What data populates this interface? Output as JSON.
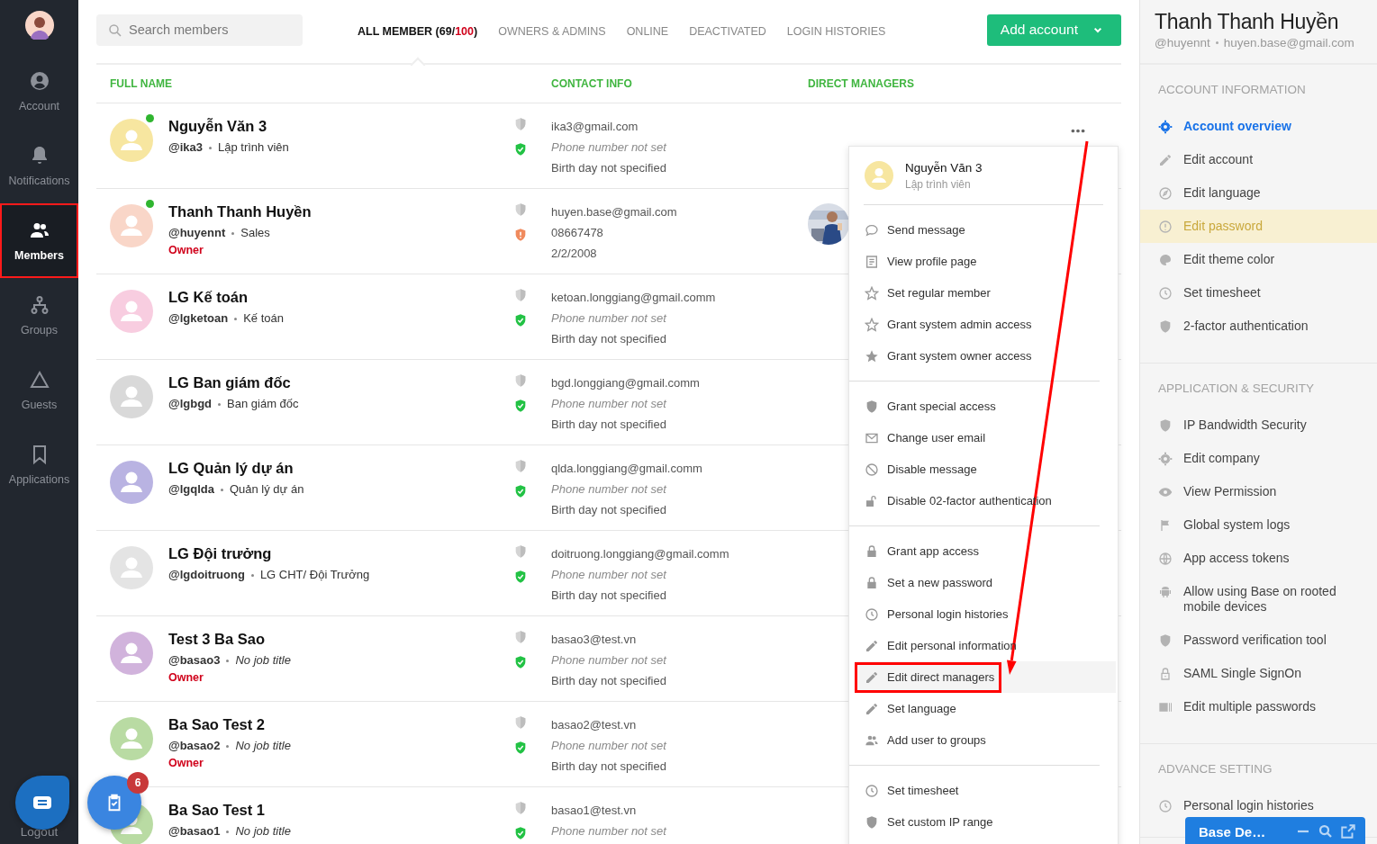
{
  "nav": {
    "items": [
      {
        "label": "Account",
        "selected": false,
        "highlighted": false
      },
      {
        "label": "Notifications",
        "selected": false,
        "highlighted": false
      },
      {
        "label": "Members",
        "selected": true,
        "highlighted": true
      },
      {
        "label": "Groups",
        "selected": false,
        "highlighted": false
      },
      {
        "label": "Guests",
        "selected": false,
        "highlighted": false
      },
      {
        "label": "Applications",
        "selected": false,
        "highlighted": false
      }
    ],
    "logout": "Logout"
  },
  "search": {
    "placeholder": "Search members"
  },
  "tabs": [
    {
      "label": "ALL MEMBER (69/",
      "limit": "100",
      "suffix": ")",
      "selected": true
    },
    {
      "label": "OWNERS & ADMINS",
      "selected": false
    },
    {
      "label": "ONLINE",
      "selected": false
    },
    {
      "label": "DEACTIVATED",
      "selected": false
    },
    {
      "label": "LOGIN HISTORIES",
      "selected": false
    }
  ],
  "add_button": {
    "label": "Add account"
  },
  "columns": [
    "FULL NAME",
    "CONTACT INFO",
    "DIRECT MANAGERS"
  ],
  "members": [
    {
      "name": "Nguyễn Văn 3",
      "username": "@ika3",
      "job": "Lập trình viên",
      "job_missing": false,
      "online": true,
      "color": "#f7e6a0",
      "verified": true,
      "email": "ika3@gmail.com",
      "phone": "Phone number not set",
      "phone_missing": true,
      "birthday": "Birth day not specified",
      "has_manager": false,
      "hovered": true
    },
    {
      "name": "Thanh Thanh Huyền",
      "username": "@huyennt",
      "job": "Sales",
      "job_missing": false,
      "role": "Owner",
      "online": true,
      "color": "#f9d6c8",
      "verified": false,
      "email": "huyen.base@gmail.com",
      "phone": "08667478",
      "phone_missing": false,
      "birthday": "2/2/2008",
      "has_manager": true,
      "hovered": false
    },
    {
      "name": "LG Kế toán",
      "username": "@lgketoan",
      "job": "Kế toán",
      "job_missing": false,
      "online": false,
      "color": "#f8cde0",
      "verified": true,
      "email": "ketoan.longgiang@gmail.comm",
      "phone": "Phone number not set",
      "phone_missing": true,
      "birthday": "Birth day not specified",
      "has_manager": false,
      "hovered": false
    },
    {
      "name": "LG Ban giám đốc",
      "username": "@lgbgd",
      "job": "Ban giám đốc",
      "job_missing": false,
      "online": false,
      "color": "#d9d9d9",
      "verified": true,
      "email": "bgd.longgiang@gmail.comm",
      "phone": "Phone number not set",
      "phone_missing": true,
      "birthday": "Birth day not specified",
      "has_manager": false,
      "hovered": false
    },
    {
      "name": "LG Quản lý dự án",
      "username": "@lgqlda",
      "job": "Quản lý dự án",
      "job_missing": false,
      "online": false,
      "color": "#b9b3e2",
      "verified": true,
      "email": "qlda.longgiang@gmail.comm",
      "phone": "Phone number not set",
      "phone_missing": true,
      "birthday": "Birth day not specified",
      "has_manager": false,
      "hovered": false
    },
    {
      "name": "LG Đội trưởng",
      "username": "@lgdoitruong",
      "job": "LG CHT/ Đội Trưởng",
      "job_missing": false,
      "online": false,
      "color": "#e4e4e4",
      "verified": true,
      "email": "doitruong.longgiang@gmail.comm",
      "phone": "Phone number not set",
      "phone_missing": true,
      "birthday": "Birth day not specified",
      "has_manager": false,
      "hovered": false
    },
    {
      "name": "Test 3 Ba Sao",
      "username": "@basao3",
      "job": "No job title",
      "job_missing": true,
      "role": "Owner",
      "online": false,
      "color": "#d1b3dc",
      "verified": true,
      "email": "basao3@test.vn",
      "phone": "Phone number not set",
      "phone_missing": true,
      "birthday": "Birth day not specified",
      "has_manager": false,
      "hovered": false
    },
    {
      "name": "Ba Sao Test 2",
      "username": "@basao2",
      "job": "No job title",
      "job_missing": true,
      "role": "Owner",
      "online": false,
      "color": "#b9dba3",
      "verified": true,
      "email": "basao2@test.vn",
      "phone": "Phone number not set",
      "phone_missing": true,
      "birthday": "Birth day not specified",
      "has_manager": false,
      "hovered": false
    },
    {
      "name": "Ba Sao Test 1",
      "username": "@basao1",
      "job": "No job title",
      "job_missing": true,
      "online": false,
      "color": "#b9dba3",
      "verified": true,
      "email": "basao1@test.vn",
      "phone": "Phone number not set",
      "phone_missing": true,
      "has_manager": false,
      "hovered": false
    }
  ],
  "menu": {
    "header": {
      "name": "Nguyễn Văn 3",
      "subtitle": "Lập trình viên",
      "color": "#f7e6a0"
    },
    "groups": [
      [
        {
          "label": "Send message",
          "highlighted": false
        },
        {
          "label": "View profile page",
          "highlighted": false
        },
        {
          "label": "Set regular member",
          "highlighted": false
        },
        {
          "label": "Grant system admin access",
          "highlighted": false
        },
        {
          "label": "Grant system owner access",
          "highlighted": false
        }
      ],
      [
        {
          "label": "Grant special access",
          "highlighted": false
        },
        {
          "label": "Change user email",
          "highlighted": false
        },
        {
          "label": "Disable message",
          "highlighted": false
        },
        {
          "label": "Disable 02-factor authentication",
          "highlighted": false
        }
      ],
      [
        {
          "label": "Grant app access",
          "highlighted": false
        },
        {
          "label": "Set a new password",
          "highlighted": false
        },
        {
          "label": "Personal login histories",
          "highlighted": false
        },
        {
          "label": "Edit personal information",
          "highlighted": false
        },
        {
          "label": "Edit direct managers",
          "highlighted": true
        },
        {
          "label": "Set language",
          "highlighted": false
        },
        {
          "label": "Add user to groups",
          "highlighted": false
        }
      ],
      [
        {
          "label": "Set timesheet",
          "highlighted": false
        },
        {
          "label": "Set custom IP range",
          "highlighted": false
        }
      ]
    ]
  },
  "panel": {
    "title": "Thanh Thanh Huyền",
    "username": "@huyennt",
    "email": "huyen.base@gmail.com",
    "sections": [
      {
        "title": "ACCOUNT INFORMATION",
        "items": [
          {
            "label": "Account overview",
            "selected": true,
            "hovered": false
          },
          {
            "label": "Edit account",
            "selected": false,
            "hovered": false
          },
          {
            "label": "Edit language",
            "selected": false,
            "hovered": false
          },
          {
            "label": "Edit password",
            "selected": false,
            "hovered": true
          },
          {
            "label": "Edit theme color",
            "selected": false,
            "hovered": false
          },
          {
            "label": "Set timesheet",
            "selected": false,
            "hovered": false
          },
          {
            "label": "2-factor authentication",
            "selected": false,
            "hovered": false
          }
        ]
      },
      {
        "title": "APPLICATION & SECURITY",
        "items": [
          {
            "label": "IP Bandwidth Security",
            "selected": false,
            "hovered": false
          },
          {
            "label": "Edit company",
            "selected": false,
            "hovered": false
          },
          {
            "label": "View Permission",
            "selected": false,
            "hovered": false
          },
          {
            "label": "Global system logs",
            "selected": false,
            "hovered": false
          },
          {
            "label": "App access tokens",
            "selected": false,
            "hovered": false
          },
          {
            "label": "Allow using Base on rooted mobile devices",
            "selected": false,
            "hovered": false
          },
          {
            "label": "Password verification tool",
            "selected": false,
            "hovered": false
          },
          {
            "label": "SAML Single SignOn",
            "selected": false,
            "hovered": false
          },
          {
            "label": "Edit multiple passwords",
            "selected": false,
            "hovered": false
          }
        ]
      },
      {
        "title": "ADVANCE SETTING",
        "items": [
          {
            "label": "Personal login histories",
            "selected": false,
            "hovered": false
          }
        ]
      }
    ]
  },
  "task_badge": "6",
  "chat_widget": {
    "title": "Base De…"
  }
}
